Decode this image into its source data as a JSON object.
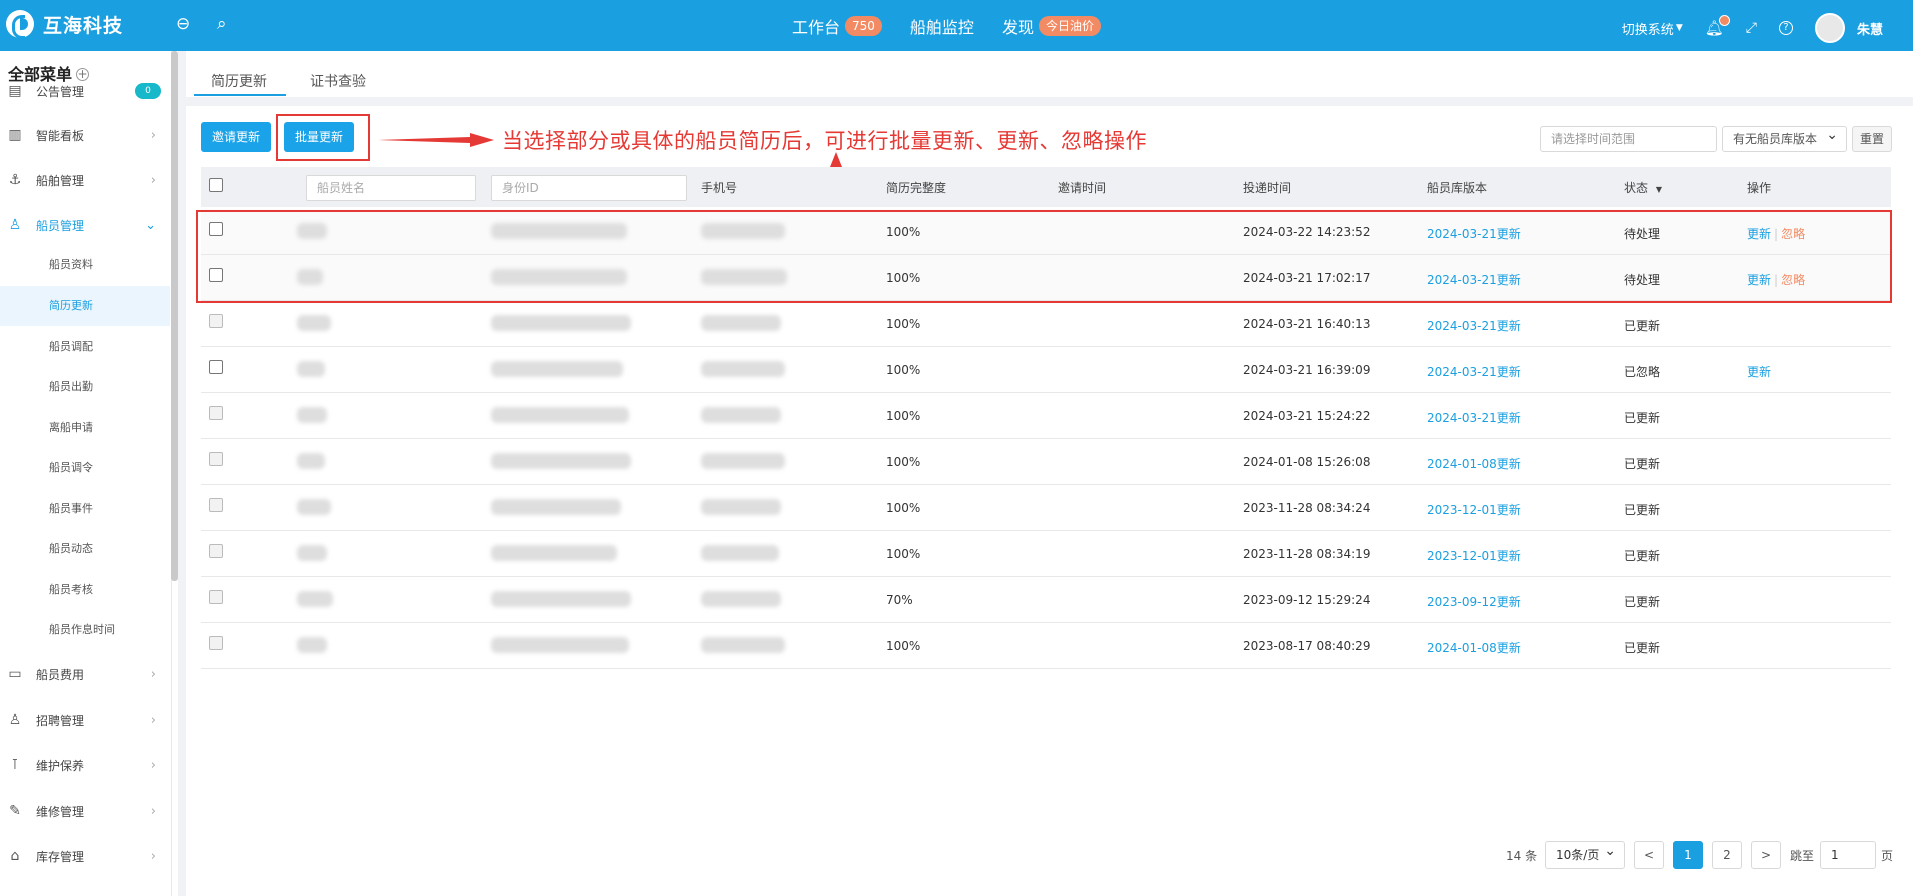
{
  "app": {
    "title": "互海科技"
  },
  "nav": [
    {
      "label": "工作台",
      "badge": "750"
    },
    {
      "label": "船舶监控",
      "badge": ""
    },
    {
      "label": "发现",
      "badge": "今日油价"
    }
  ],
  "topright": {
    "switch_system": "切换系统",
    "username": "朱慧"
  },
  "sidebar": {
    "header": "全部菜单",
    "items": [
      {
        "label": "公告管理",
        "icon": "announcement-icon",
        "badge": "0"
      },
      {
        "label": "智能看板",
        "icon": "chart-icon"
      },
      {
        "label": "船舶管理",
        "icon": "anchor-icon"
      },
      {
        "label": "船员管理",
        "icon": "user-icon"
      },
      {
        "label": "船员费用",
        "icon": "wallet-icon"
      },
      {
        "label": "招聘管理",
        "icon": "recruit-icon"
      },
      {
        "label": "维护保养",
        "icon": "maintenance-icon"
      },
      {
        "label": "维修管理",
        "icon": "wrench-icon"
      },
      {
        "label": "库存管理",
        "icon": "warehouse-icon"
      }
    ],
    "sub_items": [
      "船员资料",
      "简历更新",
      "船员调配",
      "船员出勤",
      "离船申请",
      "船员调令",
      "船员事件",
      "船员动态",
      "船员考核",
      "船员作息时间"
    ]
  },
  "tabs": [
    "简历更新",
    "证书查验"
  ],
  "toolbar": {
    "invite_button": "邀请更新",
    "batch_button": "批量更新",
    "date_placeholder": "请选择时间范围",
    "version_select": "有无船员库版本",
    "reset_button": "重置"
  },
  "annotation": "当选择部分或具体的船员简历后，可进行批量更新、更新、忽略操作",
  "table": {
    "headers": {
      "name_placeholder": "船员姓名",
      "id_placeholder": "身份ID",
      "phone": "手机号",
      "completeness": "简历完整度",
      "invite_time": "邀请时间",
      "submit_time": "投递时间",
      "version": "船员库版本",
      "status": "状态",
      "actions": "操作"
    },
    "rows": [
      {
        "completeness": "100%",
        "submit_time": "2024-03-22 14:23:52",
        "version_date": "2024-03-21",
        "version_link": "更新",
        "status": "待处理",
        "action_update": "更新",
        "action_ignore": "忽略"
      },
      {
        "completeness": "100%",
        "submit_time": "2024-03-21 17:02:17",
        "version_date": "2024-03-21",
        "version_link": "更新",
        "status": "待处理",
        "action_update": "更新",
        "action_ignore": "忽略"
      },
      {
        "completeness": "100%",
        "submit_time": "2024-03-21 16:40:13",
        "version_date": "2024-03-21",
        "version_link": "更新",
        "status": "已更新",
        "action_update": "",
        "action_ignore": ""
      },
      {
        "completeness": "100%",
        "submit_time": "2024-03-21 16:39:09",
        "version_date": "2024-03-21",
        "version_link": "更新",
        "status": "已忽略",
        "action_update": "更新",
        "action_ignore": ""
      },
      {
        "completeness": "100%",
        "submit_time": "2024-03-21 15:24:22",
        "version_date": "2024-03-21",
        "version_link": "更新",
        "status": "已更新",
        "action_update": "",
        "action_ignore": ""
      },
      {
        "completeness": "100%",
        "submit_time": "2024-01-08 15:26:08",
        "version_date": "2024-01-08",
        "version_link": "更新",
        "status": "已更新",
        "action_update": "",
        "action_ignore": ""
      },
      {
        "completeness": "100%",
        "submit_time": "2023-11-28 08:34:24",
        "version_date": "2023-12-01",
        "version_link": "更新",
        "status": "已更新",
        "action_update": "",
        "action_ignore": ""
      },
      {
        "completeness": "100%",
        "submit_time": "2023-11-28 08:34:19",
        "version_date": "2023-12-01",
        "version_link": "更新",
        "status": "已更新",
        "action_update": "",
        "action_ignore": ""
      },
      {
        "completeness": "70%",
        "submit_time": "2023-09-12 15:29:24",
        "version_date": "2023-09-12",
        "version_link": "更新",
        "status": "已更新",
        "action_update": "",
        "action_ignore": ""
      },
      {
        "completeness": "100%",
        "submit_time": "2023-08-17 08:40:29",
        "version_date": "2024-01-08",
        "version_link": "更新",
        "status": "已更新",
        "action_update": "",
        "action_ignore": ""
      }
    ]
  },
  "pagination": {
    "total": "14 条",
    "page_size": "10条/页",
    "prev": "<",
    "next": ">",
    "pages": [
      "1",
      "2"
    ],
    "jump_label": "跳至",
    "jump_value": "1",
    "page_suffix": "页"
  }
}
